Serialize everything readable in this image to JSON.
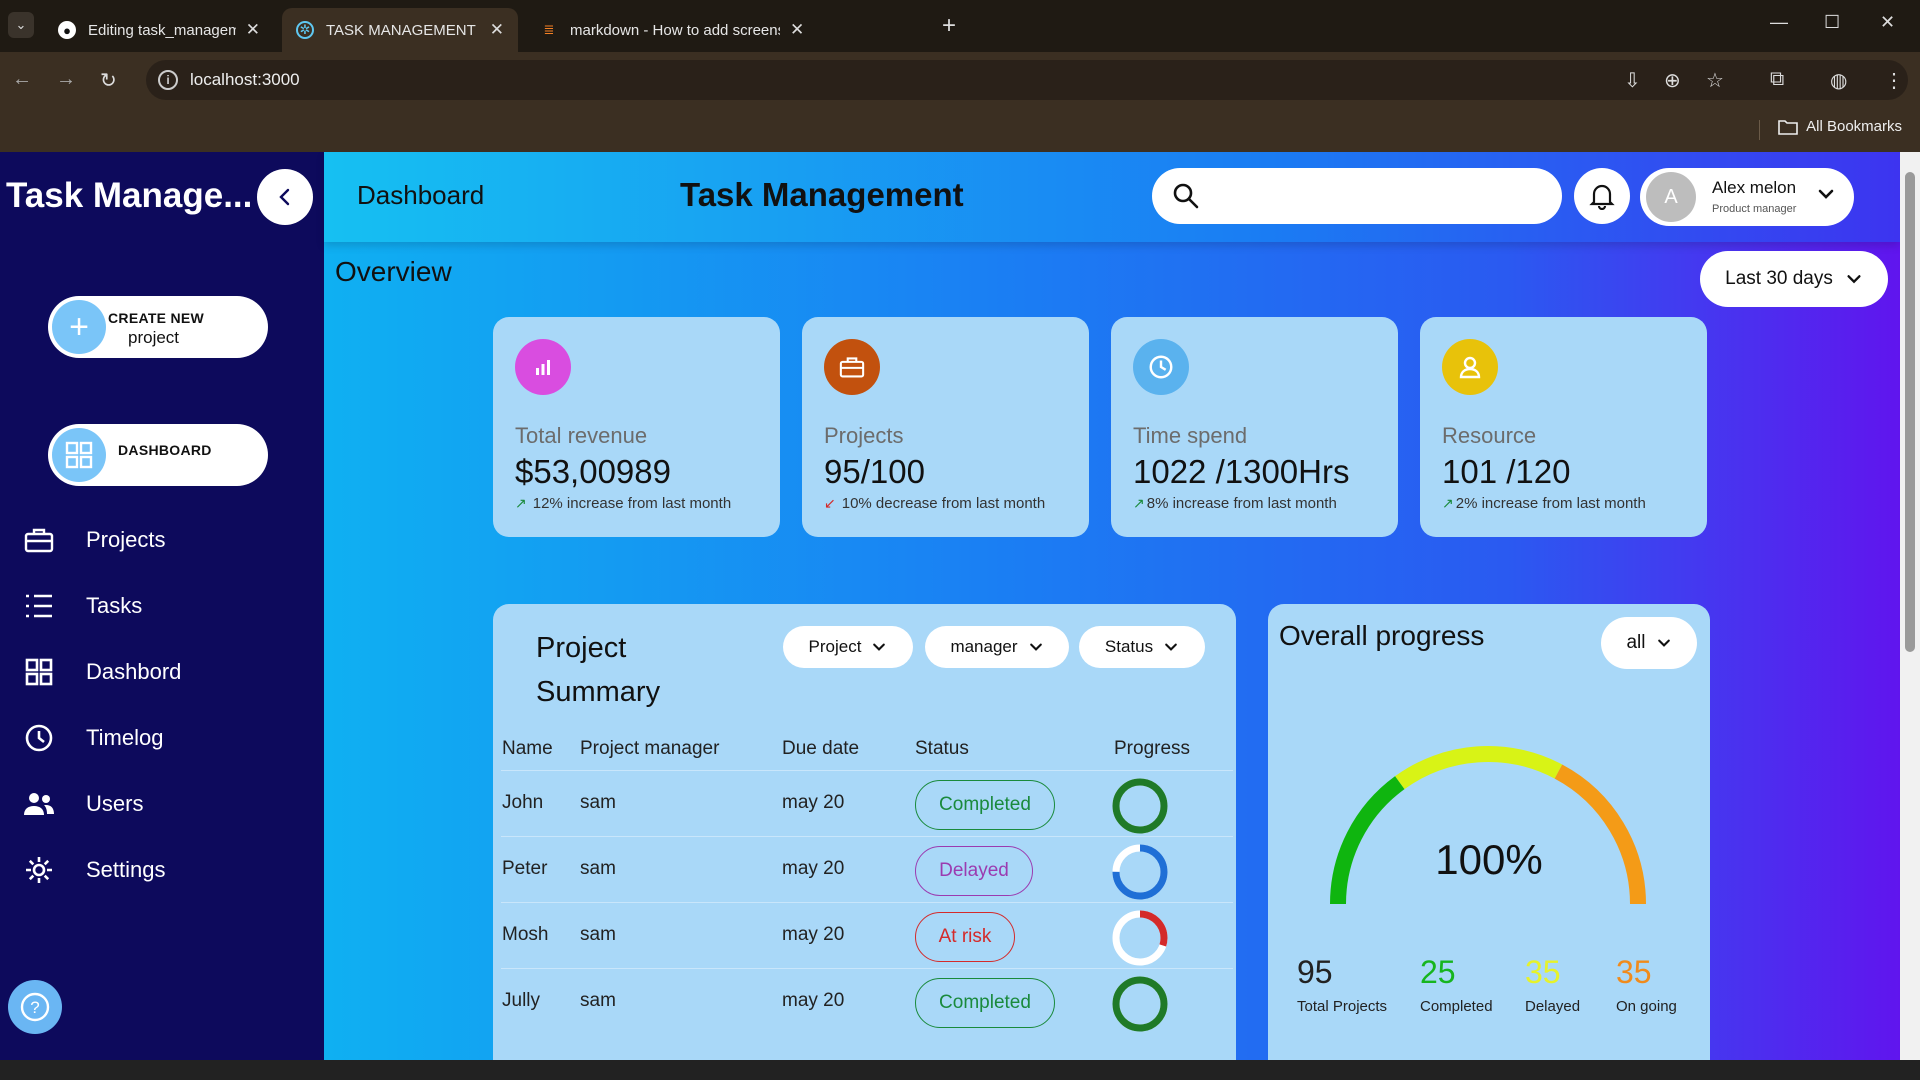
{
  "browser": {
    "tabs": [
      {
        "title": "Editing task_management/README.md",
        "close": "✕"
      },
      {
        "title": "TASK MANAGEMENT",
        "close": "✕"
      },
      {
        "title": "markdown - How to add screenshots",
        "close": "✕"
      }
    ],
    "url": "localhost:3000",
    "bookmarks_label": "All Bookmarks"
  },
  "sidebar": {
    "brand": "Task Manage...",
    "create": {
      "line1": "CREATE NEW",
      "line2": "project"
    },
    "dashboard_button": "DASHBOARD",
    "items": [
      {
        "label": "Projects",
        "icon": "briefcase-icon"
      },
      {
        "label": "Tasks",
        "icon": "list-icon"
      },
      {
        "label": "Dashbord",
        "icon": "grid-icon"
      },
      {
        "label": "Timelog",
        "icon": "timer-icon"
      },
      {
        "label": "Users",
        "icon": "users-icon"
      },
      {
        "label": "Settings",
        "icon": "gear-icon"
      }
    ]
  },
  "header": {
    "breadcrumb": "Dashboard",
    "title": "Task Management",
    "search_value": "",
    "user": {
      "initial": "A",
      "name": "Alex melon",
      "role": "Product manager"
    }
  },
  "overview": {
    "title": "Overview",
    "range": "Last 30 days",
    "cards": [
      {
        "label": "Total revenue",
        "value": "$53,00989",
        "trend": "12% increase from last month",
        "direction": "up",
        "color": "#d94de0"
      },
      {
        "label": "Projects",
        "value": "95/100",
        "trend": "10% decrease from last month",
        "direction": "down",
        "color": "#c2510e"
      },
      {
        "label": "Time spend",
        "value": "1022 /1300Hrs",
        "trend": "8% increase from last month",
        "direction": "up",
        "color": "#5ab2ee"
      },
      {
        "label": "Resource",
        "value": "101 /120",
        "trend": "2% increase from last month",
        "direction": "up",
        "color": "#e8c20a"
      }
    ]
  },
  "project_summary": {
    "title_line1": "Project",
    "title_line2": "Summary",
    "filters": [
      "Project",
      "manager",
      "Status"
    ],
    "columns": [
      "Name",
      "Project manager",
      "Due date",
      "Status",
      "Progress"
    ],
    "rows": [
      {
        "name": "John",
        "manager": "sam",
        "due": "may 20",
        "status": "Completed",
        "progress": 1.0
      },
      {
        "name": "Peter",
        "manager": "sam",
        "due": "may 20",
        "status": "Delayed",
        "progress": 0.75
      },
      {
        "name": "Mosh",
        "manager": "sam",
        "due": "may 20",
        "status": "At risk",
        "progress": 0.3
      },
      {
        "name": "Jully",
        "manager": "sam",
        "due": "may 20",
        "status": "Completed",
        "progress": 1.0
      }
    ],
    "status_colors": {
      "Completed": "#1a8a3c",
      "Delayed": "#9b3bb0",
      "At risk": "#d42a2a"
    },
    "progress_colors": {
      "Completed": "#1f7a28",
      "Delayed": "#1f6fd6",
      "At risk": "#d42a2a"
    }
  },
  "overall_progress": {
    "title": "Overall progress",
    "filter": "all",
    "percent_label": "100%",
    "legend": [
      {
        "value": "95",
        "label": "Total Projects",
        "color": "#222222"
      },
      {
        "value": "25",
        "label": "Completed",
        "color": "#17b51f"
      },
      {
        "value": "35",
        "label": "Delayed",
        "color": "#e6f22b"
      },
      {
        "value": "35",
        "label": "On going",
        "color": "#f08b1c"
      }
    ],
    "arc_colors": [
      "#0fb50f",
      "#d8f316",
      "#f49b17"
    ]
  }
}
